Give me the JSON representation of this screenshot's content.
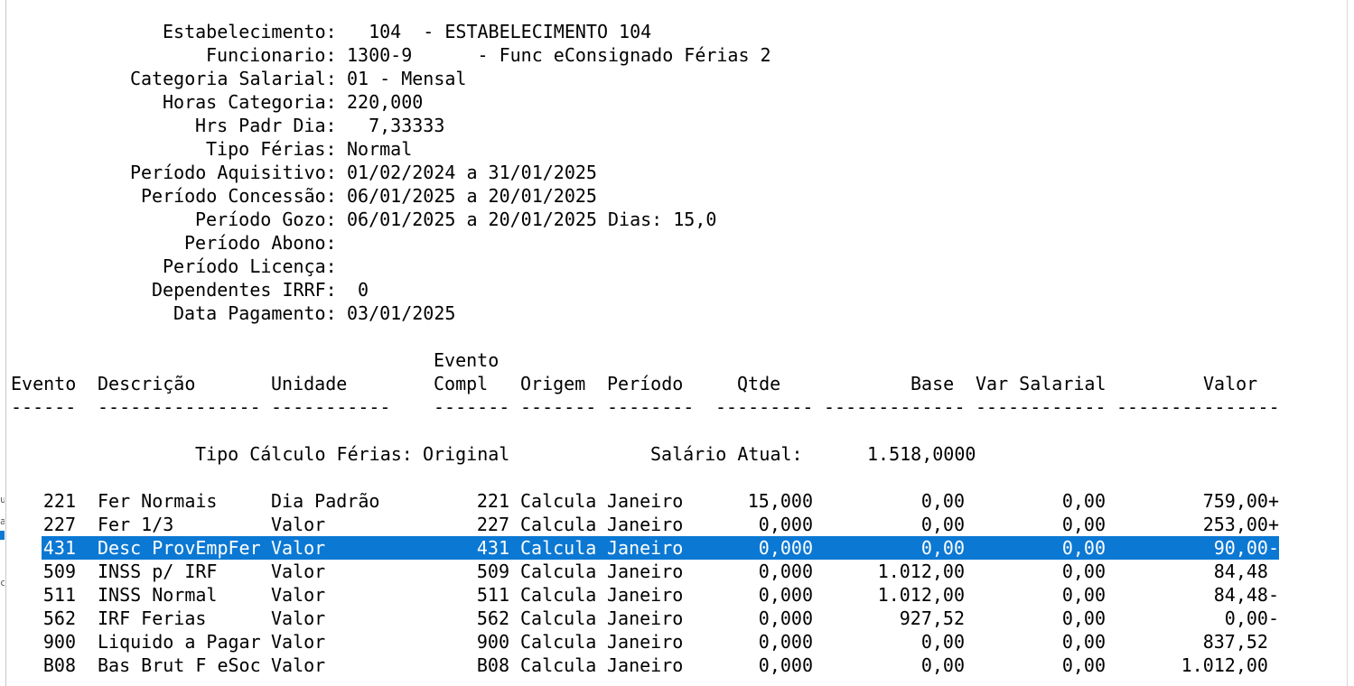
{
  "header_fields": [
    {
      "label": "Estabelecimento:",
      "value": "  104  - ESTABELECIMENTO 104"
    },
    {
      "label": "Funcionario:",
      "value": "1300-9      - Func eConsignado Férias 2"
    },
    {
      "label": "Categoria Salarial:",
      "value": "01 - Mensal"
    },
    {
      "label": "Horas Categoria:",
      "value": "220,000"
    },
    {
      "label": "Hrs Padr Dia:",
      "value": "  7,33333"
    },
    {
      "label": "Tipo Férias:",
      "value": "Normal"
    },
    {
      "label": "Período Aquisitivo:",
      "value": "01/02/2024 a 31/01/2025"
    },
    {
      "label": "Período Concessão:",
      "value": "06/01/2025 a 20/01/2025"
    },
    {
      "label": "Período Gozo:",
      "value": "06/01/2025 a 20/01/2025 Dias: 15,0"
    },
    {
      "label": "Período Abono:",
      "value": ""
    },
    {
      "label": "Período Licença:",
      "value": ""
    },
    {
      "label": "Dependentes IRRF:",
      "value": " 0"
    },
    {
      "label": "Data Pagamento:",
      "value": "03/01/2025"
    }
  ],
  "table": {
    "header_top": {
      "evento_compl": "Evento"
    },
    "columns": {
      "evento": "Evento",
      "descricao": "Descrição",
      "unidade": "Unidade",
      "evento_compl": "Compl",
      "origem": "Origem",
      "periodo": "Período",
      "qtde": "Qtde",
      "base": "Base",
      "var_salarial": "Var Salarial",
      "valor": "Valor"
    },
    "separators": {
      "evento": "------",
      "descricao": "---------------",
      "unidade": "-----------",
      "evento_compl": "-------",
      "origem": "-------",
      "periodo": "--------",
      "qtde": "---------",
      "base": "-------------",
      "var_salarial": "------------",
      "valor": "---------------"
    }
  },
  "calc_info": {
    "tipo_label": "Tipo Cálculo Férias:",
    "tipo_value": "Original",
    "salario_label": "Salário Atual:",
    "salario_value": "1.518,0000"
  },
  "rows": [
    {
      "evento": "221",
      "descricao": "Fer Normais",
      "unidade": "Dia Padrão",
      "compl": "221",
      "origem": "Calcula",
      "periodo": "Janeiro",
      "qtde": "15,000",
      "base": "0,00",
      "var": "0,00",
      "valor": "759,00+",
      "selected": false
    },
    {
      "evento": "227",
      "descricao": "Fer 1/3",
      "unidade": "Valor",
      "compl": "227",
      "origem": "Calcula",
      "periodo": "Janeiro",
      "qtde": "0,000",
      "base": "0,00",
      "var": "0,00",
      "valor": "253,00+",
      "selected": false
    },
    {
      "evento": "431",
      "descricao": "Desc ProvEmpFer",
      "unidade": "Valor",
      "compl": "431",
      "origem": "Calcula",
      "periodo": "Janeiro",
      "qtde": "0,000",
      "base": "0,00",
      "var": "0,00",
      "valor": "90,00-",
      "selected": true
    },
    {
      "evento": "509",
      "descricao": "INSS p/ IRF",
      "unidade": "Valor",
      "compl": "509",
      "origem": "Calcula",
      "periodo": "Janeiro",
      "qtde": "0,000",
      "base": "1.012,00",
      "var": "0,00",
      "valor": "84,48 ",
      "selected": false
    },
    {
      "evento": "511",
      "descricao": "INSS Normal",
      "unidade": "Valor",
      "compl": "511",
      "origem": "Calcula",
      "periodo": "Janeiro",
      "qtde": "0,000",
      "base": "1.012,00",
      "var": "0,00",
      "valor": "84,48-",
      "selected": false
    },
    {
      "evento": "562",
      "descricao": "IRF Ferias",
      "unidade": "Valor",
      "compl": "562",
      "origem": "Calcula",
      "periodo": "Janeiro",
      "qtde": "0,000",
      "base": "927,52",
      "var": "0,00",
      "valor": "0,00-",
      "selected": false
    },
    {
      "evento": "900",
      "descricao": "Liquido a Pagar",
      "unidade": "Valor",
      "compl": "900",
      "origem": "Calcula",
      "periodo": "Janeiro",
      "qtde": "0,000",
      "base": "0,00",
      "var": "0,00",
      "valor": "837,52 ",
      "selected": false
    },
    {
      "evento": "B08",
      "descricao": "Bas Brut F eSoc",
      "unidade": "Valor",
      "compl": "B08",
      "origem": "Calcula",
      "periodo": "Janeiro",
      "qtde": "0,000",
      "base": "0,00",
      "var": "0,00",
      "valor": "1.012,00 ",
      "selected": false
    }
  ],
  "colors": {
    "selection": "#0b78d4",
    "selection_text": "#ffffff",
    "text": "#000000",
    "background": "#ffffff"
  }
}
